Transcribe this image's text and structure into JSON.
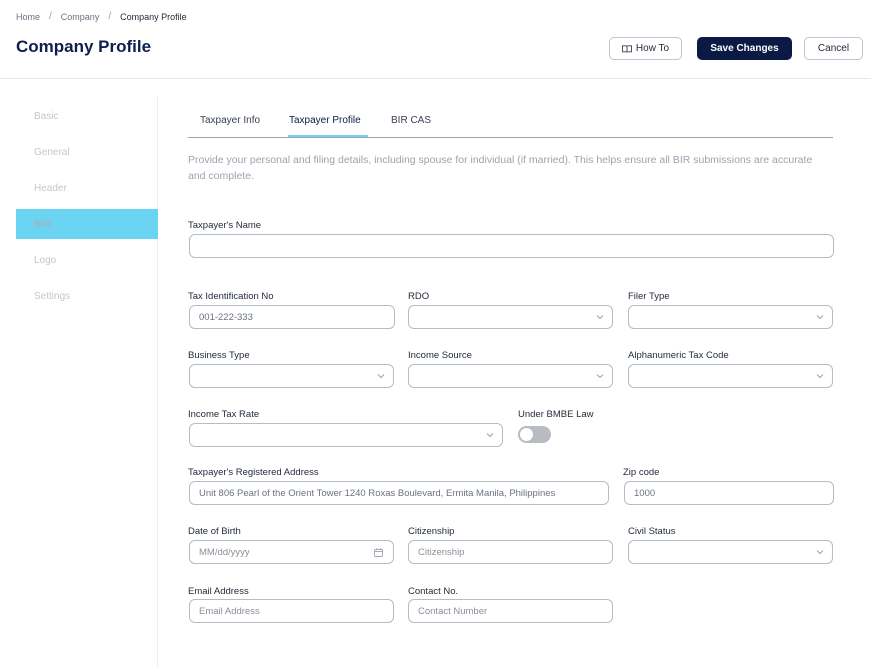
{
  "breadcrumb": {
    "home": "Home",
    "company": "Company",
    "current": "Company Profile",
    "separator": "/"
  },
  "page_title": "Company Profile",
  "actions": {
    "how_to": "How To",
    "save": "Save Changes",
    "cancel": "Cancel"
  },
  "sidebar": {
    "items": [
      {
        "label": "Basic"
      },
      {
        "label": "General"
      },
      {
        "label": "Header"
      },
      {
        "label": "BIR",
        "active": true
      },
      {
        "label": "Logo"
      },
      {
        "label": "Settings"
      }
    ]
  },
  "tabs": [
    {
      "label": "Taxpayer Info"
    },
    {
      "label": "Taxpayer Profile",
      "active": true
    },
    {
      "label": "BIR CAS"
    }
  ],
  "intro": "Provide your personal and filing details, including spouse for individual (if married). This helps ensure all BIR submissions are accurate and complete.",
  "form": {
    "taxpayer_name": {
      "label": "Taxpayer's Name",
      "value": ""
    },
    "tin": {
      "label": "Tax Identification No",
      "value": "001-222-333"
    },
    "rdo": {
      "label": "RDO",
      "value": ""
    },
    "filer_type": {
      "label": "Filer Type",
      "value": ""
    },
    "business_type": {
      "label": "Business Type",
      "value": ""
    },
    "income_source": {
      "label": "Income Source",
      "value": ""
    },
    "atc": {
      "label": "Alphanumeric Tax Code",
      "value": ""
    },
    "income_tax_rate": {
      "label": "Income Tax Rate",
      "value": ""
    },
    "bmbe": {
      "label": "Under BMBE Law",
      "on": false
    },
    "address": {
      "label": "Taxpayer's Registered Address",
      "value": "Unit 806 Pearl of the Orient Tower 1240 Roxas Boulevard, Ermita Manila, Philippines"
    },
    "zip": {
      "label": "Zip code",
      "value": "1000"
    },
    "dob": {
      "label": "Date of Birth",
      "placeholder": "MM/dd/yyyy"
    },
    "citizenship": {
      "label": "Citizenship",
      "placeholder": "Citizenship"
    },
    "civil_status": {
      "label": "Civil Status",
      "value": ""
    },
    "email": {
      "label": "Email Address",
      "placeholder": "Email Address"
    },
    "contact": {
      "label": "Contact No.",
      "placeholder": "Contact Number"
    }
  },
  "icons": {
    "how_to": "book-icon",
    "dropdown": "chevron-down-icon",
    "date": "calendar-icon"
  },
  "colors": {
    "primary": "#0b1a45",
    "accent": "#6ad4f2"
  }
}
